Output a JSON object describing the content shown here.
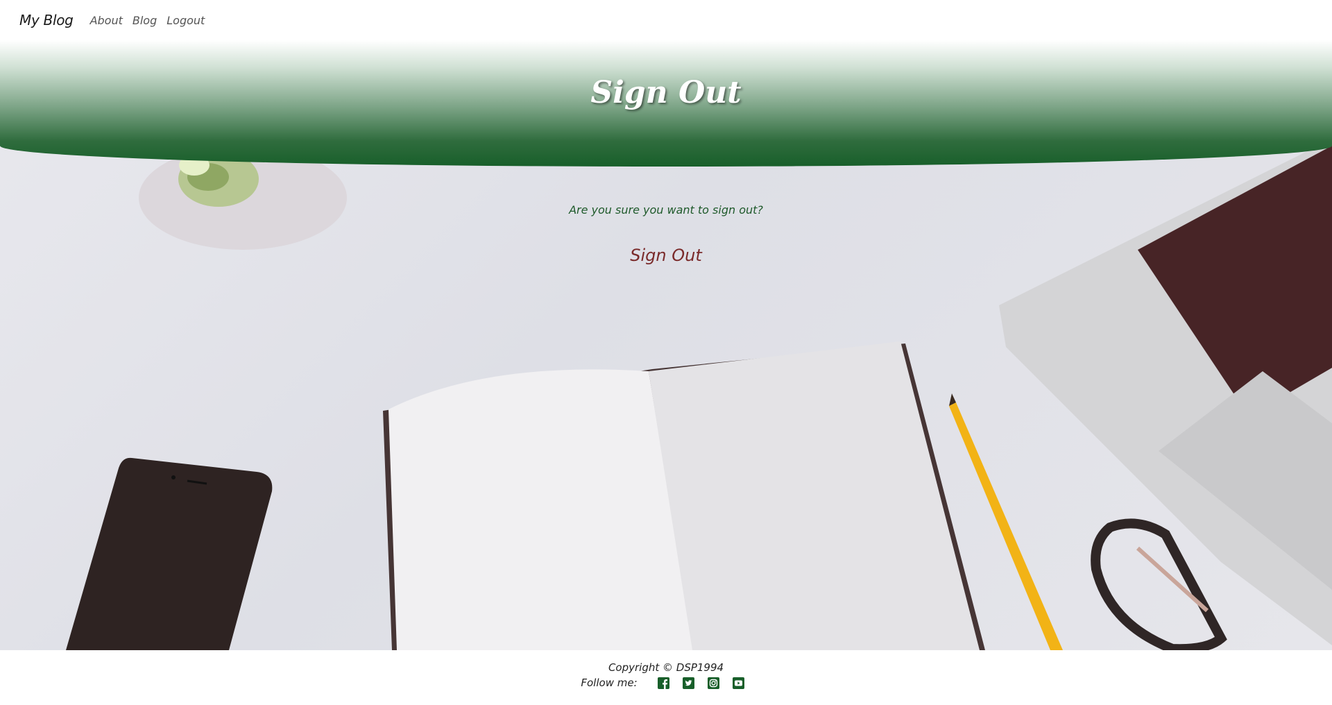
{
  "nav": {
    "brand": "My Blog",
    "links": [
      "About",
      "Blog",
      "Logout"
    ]
  },
  "hero": {
    "title": "Sign Out"
  },
  "main": {
    "prompt": "Are you sure you want to sign out?",
    "button_label": "Sign Out"
  },
  "footer": {
    "copyright": "Copyright © DSP1994",
    "follow_label": "Follow me:",
    "social_icons": [
      "facebook-icon",
      "twitter-icon",
      "instagram-icon",
      "youtube-icon"
    ]
  },
  "colors": {
    "brand_green": "#185f2a",
    "button_red": "#7a2a2a",
    "text_green": "#1f5a2b"
  }
}
